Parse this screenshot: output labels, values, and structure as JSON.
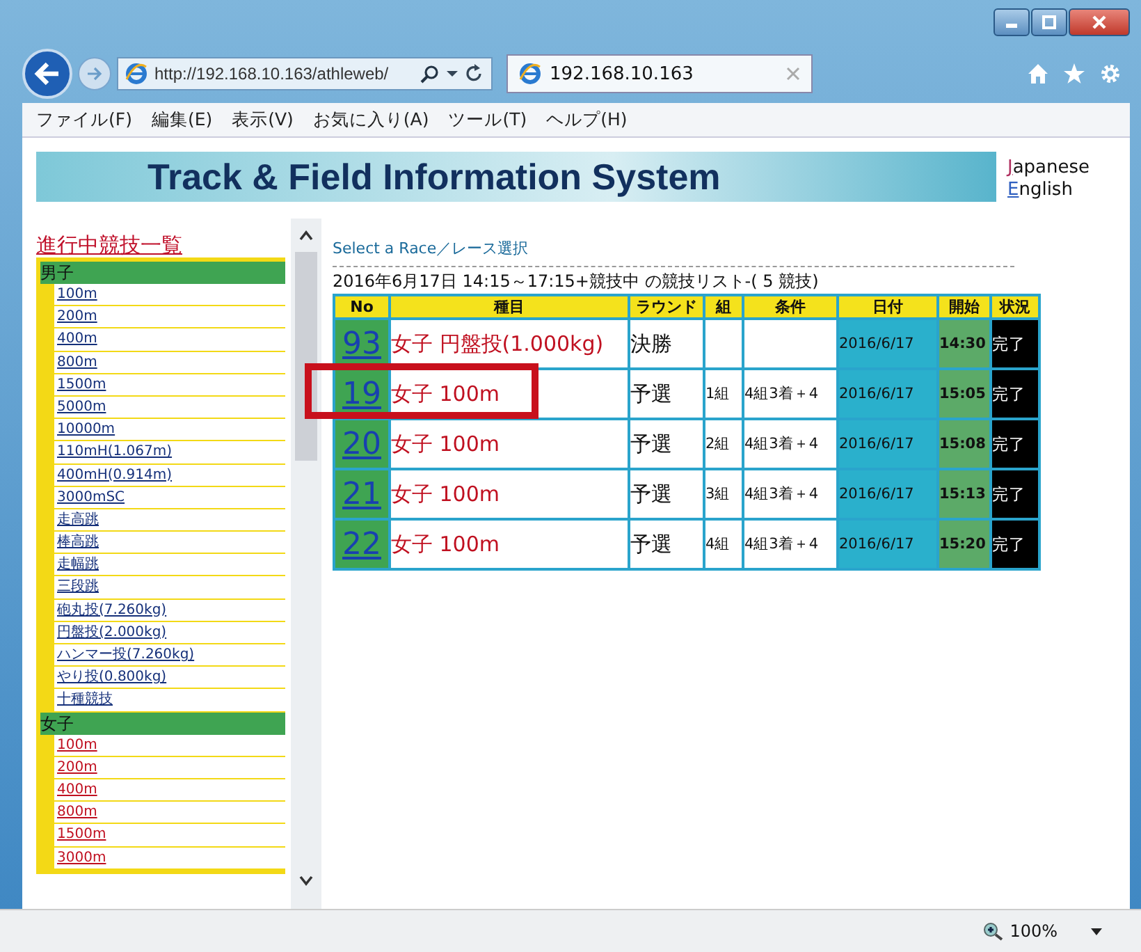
{
  "browser": {
    "address": "http://192.168.10.163/athleweb/",
    "tab_title": "192.168.10.163"
  },
  "menu": [
    "ファイル(F)",
    "編集(E)",
    "表示(V)",
    "お気に入り(A)",
    "ツール(T)",
    "ヘルプ(H)"
  ],
  "banner": {
    "title": "Track & Field Information System",
    "languages": [
      "Japanese",
      "English"
    ]
  },
  "sidebar": {
    "heading": "進行中競技一覧",
    "groups": [
      {
        "label": "男子",
        "kind": "men",
        "items": [
          "100m",
          "200m",
          "400m",
          "800m",
          "1500m",
          "5000m",
          "10000m",
          "110mH(1.067m)",
          "400mH(0.914m)",
          "3000mSC",
          "走高跳",
          "棒高跳",
          "走幅跳",
          "三段跳",
          "砲丸投(7.260kg)",
          "円盤投(2.000kg)",
          "ハンマー投(7.260kg)",
          "やり投(0.800kg)",
          "十種競技"
        ]
      },
      {
        "label": "女子",
        "kind": "women",
        "items": [
          "100m",
          "200m",
          "400m",
          "800m",
          "1500m",
          "3000m"
        ]
      }
    ]
  },
  "race_list": {
    "heading": "Select a Race／レース選択",
    "caption": "2016年6月17日 14:15～17:15+競技中 の競技リスト-( 5 競技)",
    "columns": [
      "No",
      "種目",
      "ラウンド",
      "組",
      "条件",
      "日付",
      "開始",
      "状況"
    ],
    "rows": [
      {
        "no": "93",
        "event": "女子 円盤投(1.000kg)",
        "round": "決勝",
        "group": "",
        "condition": "",
        "date": "2016/6/17",
        "start": "14:30",
        "status": "完了",
        "marked": false
      },
      {
        "no": "19",
        "event": "女子 100m",
        "round": "予選",
        "group": "1組",
        "condition": "4組3着＋4",
        "date": "2016/6/17",
        "start": "15:05",
        "status": "完了",
        "marked": true
      },
      {
        "no": "20",
        "event": "女子 100m",
        "round": "予選",
        "group": "2組",
        "condition": "4組3着＋4",
        "date": "2016/6/17",
        "start": "15:08",
        "status": "完了",
        "marked": false
      },
      {
        "no": "21",
        "event": "女子 100m",
        "round": "予選",
        "group": "3組",
        "condition": "4組3着＋4",
        "date": "2016/6/17",
        "start": "15:13",
        "status": "完了",
        "marked": false
      },
      {
        "no": "22",
        "event": "女子 100m",
        "round": "予選",
        "group": "4組",
        "condition": "4組3着＋4",
        "date": "2016/6/17",
        "start": "15:20",
        "status": "完了",
        "marked": false
      }
    ]
  },
  "status_bar": {
    "zoom": "100%"
  }
}
